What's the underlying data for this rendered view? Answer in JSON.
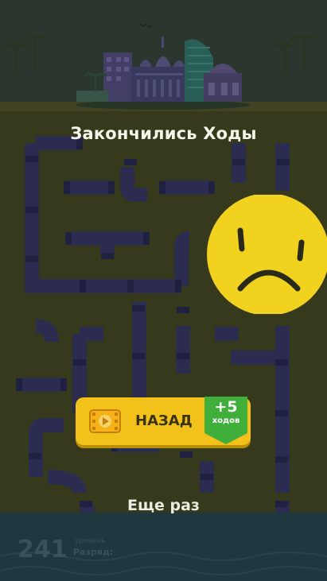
{
  "dialog": {
    "title": "Закончились Ходы",
    "back_button": "НАЗАД",
    "bonus_amount": "+5",
    "bonus_unit": "ходов",
    "retry": "Еще раз"
  },
  "footer": {
    "level": "241",
    "sub": "уровень",
    "rank_label": "Разряд:"
  },
  "icons": [
    "video-icon",
    "sad-face-icon",
    "bonus-badge-icon",
    "city-skyline-icon",
    "pipe-icon"
  ],
  "colors": {
    "button": "#f2c21b",
    "badge": "#3fae3a",
    "face": "#f1d21f",
    "pipes": "#2f2f5a",
    "board": "#3d3f1e"
  }
}
